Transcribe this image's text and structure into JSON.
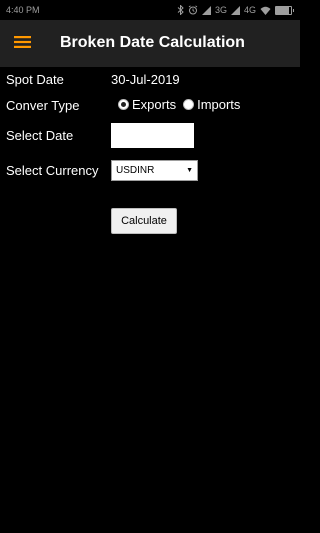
{
  "status_bar": {
    "time": "4:40 PM",
    "network_3g": "3G",
    "network_4g": "4G",
    "battery_level": 0.85
  },
  "app_bar": {
    "title": "Broken Date Calculation",
    "menu_icon": "hamburger-menu-icon",
    "menu_icon_color": "#ff9800"
  },
  "form": {
    "spot_date": {
      "label": "Spot Date",
      "value": "30-Jul-2019"
    },
    "conversion_type": {
      "label": "Conver Type",
      "options": [
        "Exports",
        "Imports"
      ],
      "selected": "Exports"
    },
    "select_date": {
      "label": "Select Date",
      "value": "",
      "placeholder": ""
    },
    "currency": {
      "label": "Select Currency",
      "selected": "USDINR"
    },
    "calculate_label": "Calculate"
  }
}
